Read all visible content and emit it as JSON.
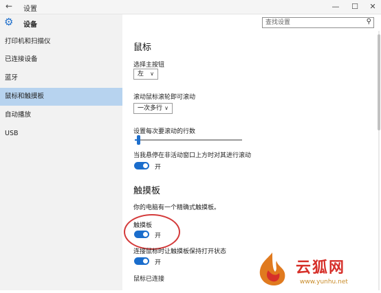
{
  "window": {
    "title": "设置",
    "back": "←",
    "min": "—",
    "max": "☐",
    "close": "✕"
  },
  "app": {
    "title": "设备",
    "icon": "gear-icon"
  },
  "search": {
    "placeholder": "查找设置",
    "icon": "search-icon"
  },
  "sidebar": {
    "items": [
      {
        "label": "打印机和扫描仪",
        "active": false
      },
      {
        "label": "已连接设备",
        "active": false
      },
      {
        "label": "蓝牙",
        "active": false
      },
      {
        "label": "鼠标和触摸板",
        "active": true
      },
      {
        "label": "自动播放",
        "active": false
      },
      {
        "label": "USB",
        "active": false
      }
    ]
  },
  "mouse": {
    "heading": "鼠标",
    "primary_button_label": "选择主按钮",
    "primary_button_value": "左",
    "scroll_label": "滚动鼠标滚轮即可滚动",
    "scroll_value": "一次多行",
    "lines_label": "设置每次要滚动的行数",
    "lines_fraction": 0.03,
    "inactive_label": "当我悬停在非活动窗口上方时对其进行滚动",
    "inactive_state": "开"
  },
  "touchpad": {
    "heading": "触摸板",
    "description": "你的电脑有一个精确式触摸板。",
    "touchpad_label": "触摸板",
    "touchpad_state": "开",
    "keep_on_label": "连接鼠标时让触摸板保持打开状态",
    "keep_on_state": "开",
    "mouse_connected": "鼠标已连接"
  },
  "colors": {
    "accent": "#1a6dcc",
    "selection": "#b7d3ef",
    "annotation": "#d43a3a"
  },
  "watermark": {
    "brand": "云狐网",
    "url": "www.yunhu.net"
  }
}
